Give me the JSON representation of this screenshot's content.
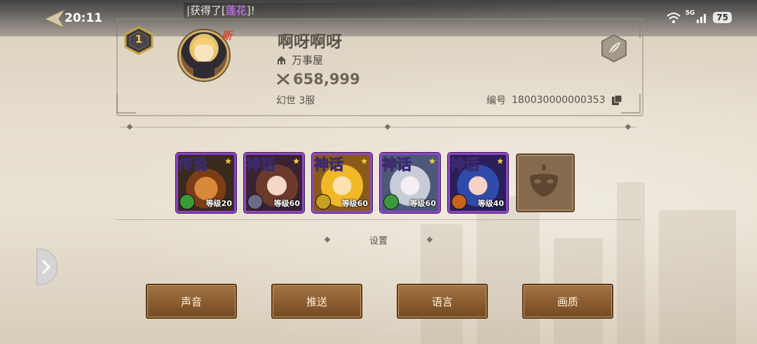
{
  "status_bar": {
    "time": "20:11",
    "marquee_prefix": "|获得了[",
    "marquee_item": "莲花",
    "marquee_suffix": "]!",
    "network": "5G",
    "battery": "75"
  },
  "profile": {
    "rank": "1",
    "new_tag": "新",
    "name": "啊呀啊呀",
    "guild": "万事屋",
    "power": "658,999",
    "server": "幻世 3服",
    "id_label": "编号",
    "id_value": "180030000000353"
  },
  "heroes": [
    {
      "tier": "传说",
      "level": "等级20",
      "tier_color": "#ffcf4a",
      "faction_color": "#3a9a3a"
    },
    {
      "tier": "神话",
      "level": "等级60",
      "tier_color": "#ffffff",
      "faction_color": "#6a6a8a"
    },
    {
      "tier": "神话",
      "level": "等级60",
      "tier_color": "#ffffff",
      "faction_color": "#c9a020"
    },
    {
      "tier": "神话",
      "level": "等级60",
      "tier_color": "#ffffff",
      "faction_color": "#3a9a3a"
    },
    {
      "tier": "神话",
      "level": "等级40",
      "tier_color": "#ffffff",
      "faction_color": "#c5641a"
    }
  ],
  "settings": {
    "title": "设置",
    "buttons": [
      "声音",
      "推送",
      "语言",
      "画质"
    ]
  }
}
